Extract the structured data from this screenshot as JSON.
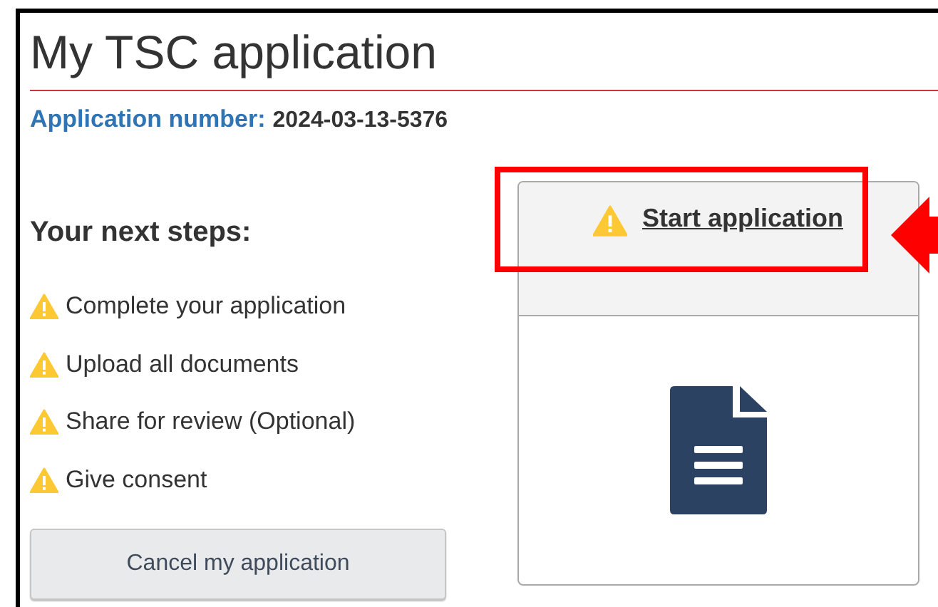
{
  "title": "My TSC application",
  "application_number": {
    "label": "Application number:",
    "value": "2024-03-13-5376"
  },
  "next_steps": {
    "heading": "Your next steps:",
    "items": [
      {
        "label": "Complete your application",
        "kind": "warning"
      },
      {
        "label": "Upload all documents",
        "kind": "warning"
      },
      {
        "label": "Share for review (Optional)",
        "kind": "warning"
      },
      {
        "label": "Give consent",
        "kind": "warning"
      }
    ]
  },
  "cancel_button": "Cancel my application",
  "application_card": {
    "link": "Start application",
    "kind": "warning"
  }
}
